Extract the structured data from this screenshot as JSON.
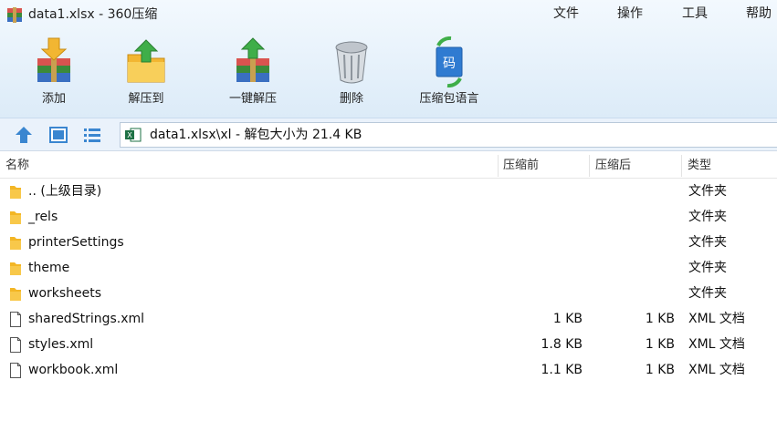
{
  "window": {
    "title": "data1.xlsx - 360压缩",
    "menu": [
      "文件",
      "操作",
      "工具",
      "帮助"
    ]
  },
  "toolbar": {
    "add": "添加",
    "extract_to": "解压到",
    "one_click_extract": "一键解压",
    "delete": "删除",
    "archive_language": "压缩包语言"
  },
  "address": {
    "path": "data1.xlsx\\xl - 解包大小为 21.4 KB"
  },
  "columns": {
    "name": "名称",
    "before": "压缩前",
    "after": "压缩后",
    "type": "类型"
  },
  "files": [
    {
      "name": ".. (上级目录)",
      "before": "",
      "after": "",
      "type": "文件夹",
      "icon": "folder-icon"
    },
    {
      "name": "_rels",
      "before": "",
      "after": "",
      "type": "文件夹",
      "icon": "folder-icon"
    },
    {
      "name": "printerSettings",
      "before": "",
      "after": "",
      "type": "文件夹",
      "icon": "folder-icon"
    },
    {
      "name": "theme",
      "before": "",
      "after": "",
      "type": "文件夹",
      "icon": "folder-icon"
    },
    {
      "name": "worksheets",
      "before": "",
      "after": "",
      "type": "文件夹",
      "icon": "folder-icon"
    },
    {
      "name": "sharedStrings.xml",
      "before": "1 KB",
      "after": "1 KB",
      "type": "XML 文档",
      "icon": "file-icon"
    },
    {
      "name": "styles.xml",
      "before": "1.8 KB",
      "after": "1 KB",
      "type": "XML 文档",
      "icon": "file-icon"
    },
    {
      "name": "workbook.xml",
      "before": "1.1 KB",
      "after": "1 KB",
      "type": "XML 文档",
      "icon": "file-icon"
    }
  ],
  "colors": {
    "toolbar_bg": "#dcebf8",
    "address_bg": "#eaf2fb",
    "folder": "#f3b625",
    "accent": "#3a86d0"
  }
}
